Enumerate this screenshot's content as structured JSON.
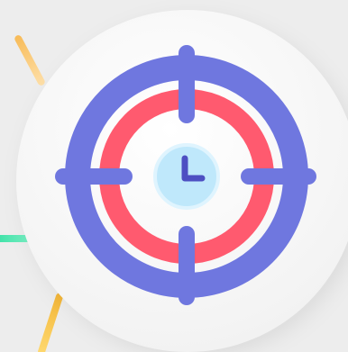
{
  "icon": {
    "name": "target-clock-icon",
    "colors": {
      "background": "#ededed",
      "disc": "#f5f5f5",
      "outer_ring": "#6f77df",
      "inner_ring": "#ff5a6f",
      "crosshair": "#6f77df",
      "clock_face": "#bfe8fb",
      "clock_hands": "#4d4fc2",
      "accent_yellow": "#f7b640",
      "accent_green": "#35dea4"
    }
  }
}
